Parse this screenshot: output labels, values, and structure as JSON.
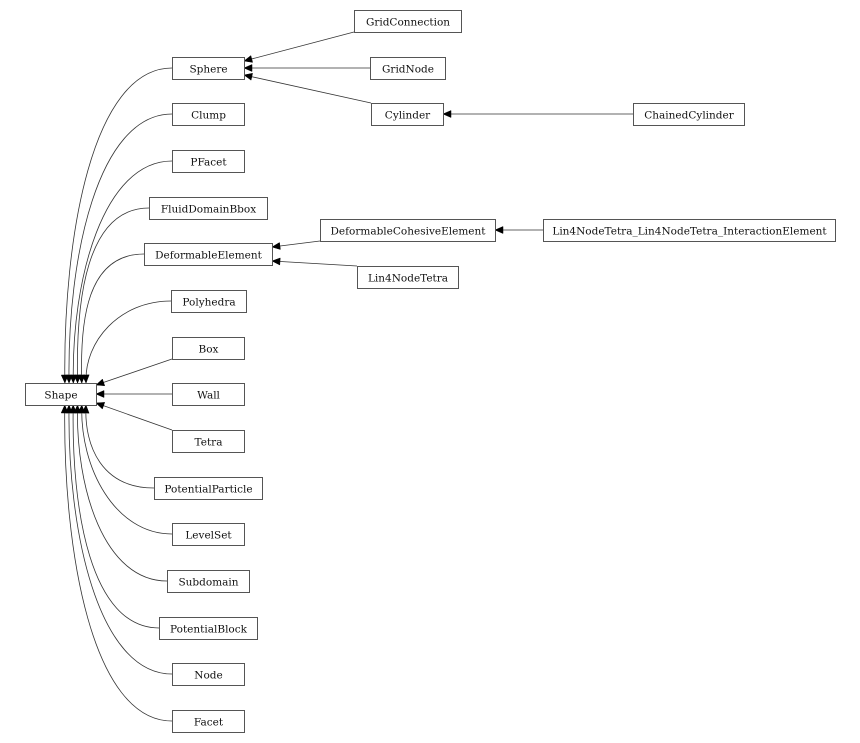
{
  "diagram": {
    "type": "class-inheritance-graph",
    "root": "Shape",
    "nodes": [
      {
        "id": "Shape",
        "label": "Shape"
      },
      {
        "id": "Sphere",
        "label": "Sphere"
      },
      {
        "id": "Clump",
        "label": "Clump"
      },
      {
        "id": "PFacet",
        "label": "PFacet"
      },
      {
        "id": "FluidDomainBbox",
        "label": "FluidDomainBbox"
      },
      {
        "id": "DeformableElement",
        "label": "DeformableElement"
      },
      {
        "id": "Polyhedra",
        "label": "Polyhedra"
      },
      {
        "id": "Box",
        "label": "Box"
      },
      {
        "id": "Wall",
        "label": "Wall"
      },
      {
        "id": "Tetra",
        "label": "Tetra"
      },
      {
        "id": "PotentialParticle",
        "label": "PotentialParticle"
      },
      {
        "id": "LevelSet",
        "label": "LevelSet"
      },
      {
        "id": "Subdomain",
        "label": "Subdomain"
      },
      {
        "id": "PotentialBlock",
        "label": "PotentialBlock"
      },
      {
        "id": "Node",
        "label": "Node"
      },
      {
        "id": "Facet",
        "label": "Facet"
      },
      {
        "id": "GridConnection",
        "label": "GridConnection"
      },
      {
        "id": "GridNode",
        "label": "GridNode"
      },
      {
        "id": "Cylinder",
        "label": "Cylinder"
      },
      {
        "id": "ChainedCylinder",
        "label": "ChainedCylinder"
      },
      {
        "id": "DeformableCohesiveElement",
        "label": "DeformableCohesiveElement"
      },
      {
        "id": "Lin4NodeTetra",
        "label": "Lin4NodeTetra"
      },
      {
        "id": "Lin4NodeTetra_Lin4NodeTetra_InteractionElement",
        "label": "Lin4NodeTetra_Lin4NodeTetra_InteractionElement"
      }
    ],
    "edges": [
      {
        "from": "Sphere",
        "to": "Shape"
      },
      {
        "from": "Clump",
        "to": "Shape"
      },
      {
        "from": "PFacet",
        "to": "Shape"
      },
      {
        "from": "FluidDomainBbox",
        "to": "Shape"
      },
      {
        "from": "DeformableElement",
        "to": "Shape"
      },
      {
        "from": "Polyhedra",
        "to": "Shape"
      },
      {
        "from": "Box",
        "to": "Shape"
      },
      {
        "from": "Wall",
        "to": "Shape"
      },
      {
        "from": "Tetra",
        "to": "Shape"
      },
      {
        "from": "PotentialParticle",
        "to": "Shape"
      },
      {
        "from": "LevelSet",
        "to": "Shape"
      },
      {
        "from": "Subdomain",
        "to": "Shape"
      },
      {
        "from": "PotentialBlock",
        "to": "Shape"
      },
      {
        "from": "Node",
        "to": "Shape"
      },
      {
        "from": "Facet",
        "to": "Shape"
      },
      {
        "from": "GridConnection",
        "to": "Sphere"
      },
      {
        "from": "GridNode",
        "to": "Sphere"
      },
      {
        "from": "Cylinder",
        "to": "Sphere"
      },
      {
        "from": "ChainedCylinder",
        "to": "Cylinder"
      },
      {
        "from": "DeformableCohesiveElement",
        "to": "DeformableElement"
      },
      {
        "from": "Lin4NodeTetra",
        "to": "DeformableElement"
      },
      {
        "from": "Lin4NodeTetra_Lin4NodeTetra_InteractionElement",
        "to": "DeformableCohesiveElement"
      }
    ]
  }
}
